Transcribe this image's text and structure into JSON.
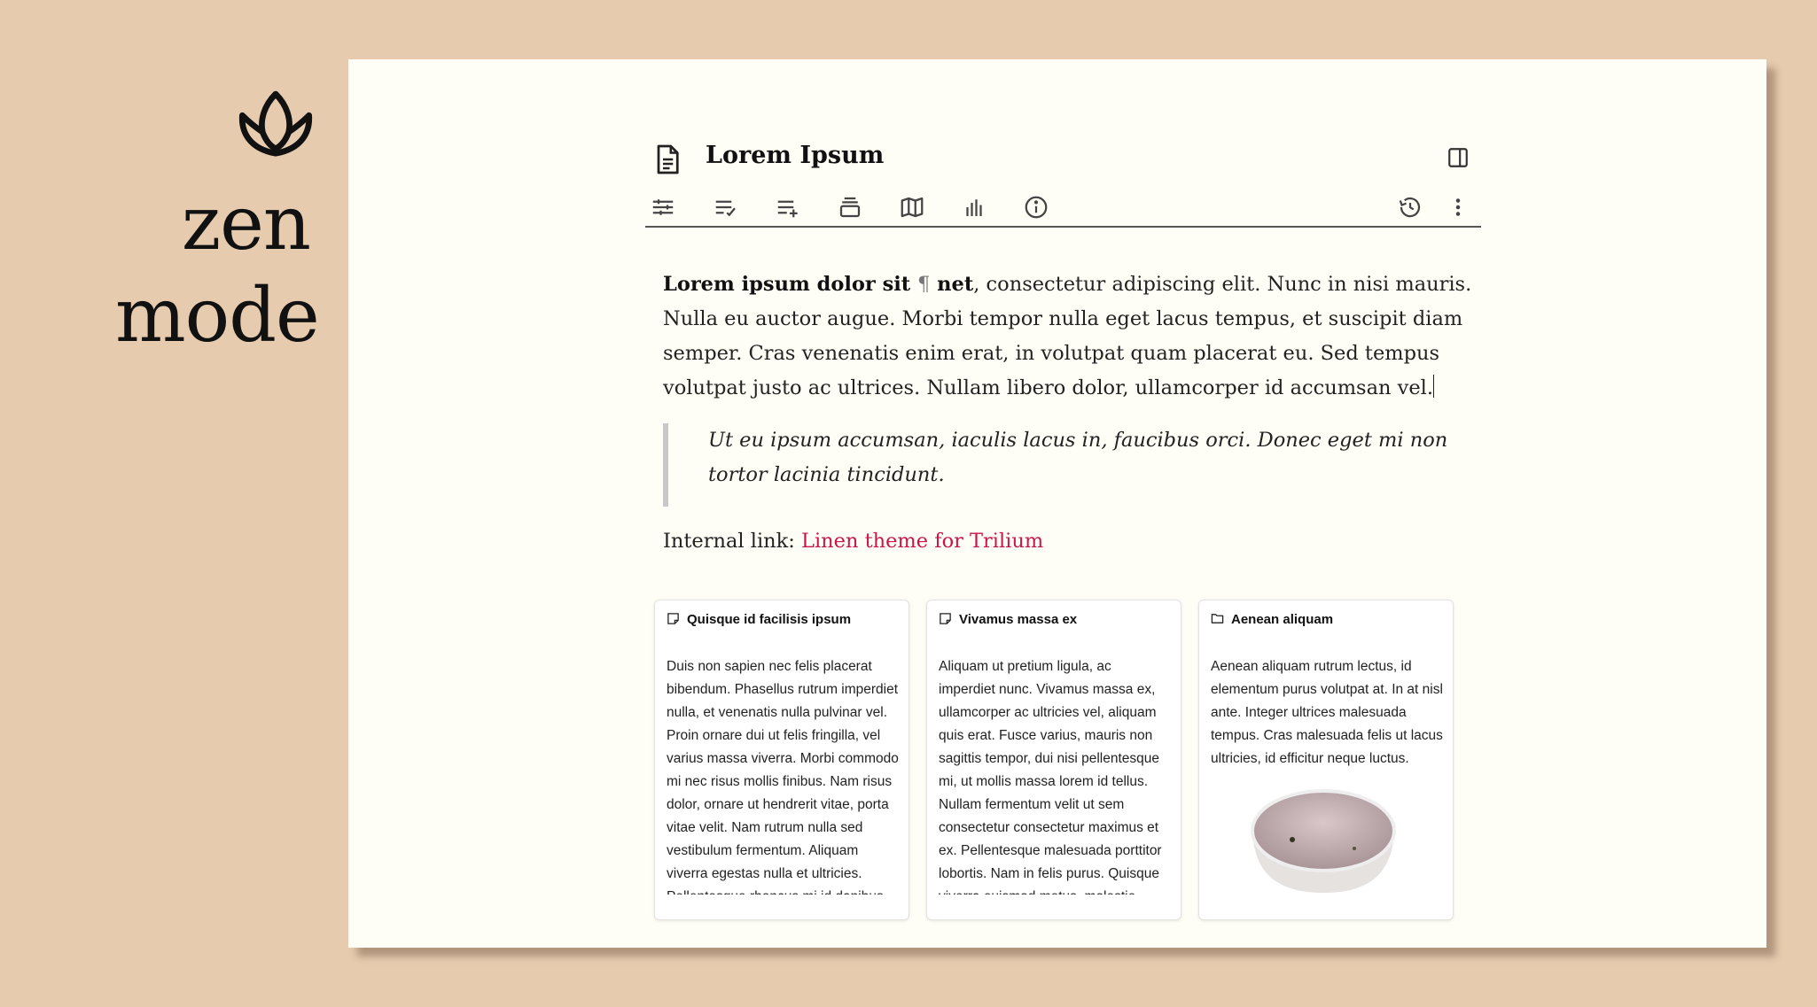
{
  "brand": {
    "line1": "zen",
    "line2": "mode",
    "logo_icon": "lotus-icon"
  },
  "note": {
    "title": "Lorem Ipsum",
    "title_icon": "document-icon",
    "panel_icon": "sidebar-panel-icon"
  },
  "toolbar": {
    "left_icons": [
      "sliders-icon",
      "edit-list-icon",
      "add-list-icon",
      "stack-icon",
      "map-icon",
      "bar-chart-icon",
      "info-icon"
    ],
    "right_icons": [
      "history-icon",
      "more-vertical-icon"
    ]
  },
  "content": {
    "bold_start": "Lorem ipsum dolor sit ",
    "pilcrow": "¶",
    "bold_end": " net",
    "paragraph_rest": ", consectetur adipiscing elit. Nunc in nisi mauris. Nulla eu auctor augue. Morbi tempor nulla eget lacus tempus, et suscipit diam semper. Cras venenatis enim erat, in volutpat quam placerat eu. Sed tempus volutpat justo ac ultrices. Nullam libero dolor, ullamcorper id accumsan vel.",
    "quote": "Ut eu ipsum accumsan, iaculis lacus in, faucibus orci. Donec eget mi non tortor lacinia tincidunt.",
    "link_label": "Internal link: ",
    "link_text": "Linen theme for Trilium"
  },
  "cards": [
    {
      "icon": "note-icon",
      "title": "Quisque id facilisis ipsum",
      "body": "Duis non sapien nec felis placerat bibendum. Phasellus rutrum imperdiet nulla, et venenatis nulla pulvinar vel. Proin ornare dui ut felis fringilla, vel varius massa viverra. Morbi commodo mi nec risus mollis finibus. Nam risus dolor, ornare ut hendrerit vitae, porta vitae velit. Nam rutrum nulla sed vestibulum fermentum. Aliquam viverra egestas nulla et ultricies. Pellentesque rhoncus mi id dapibus"
    },
    {
      "icon": "note-icon",
      "title": "Vivamus massa ex",
      "body": "Aliquam ut pretium ligula, ac imperdiet nunc. Vivamus massa ex, ullamcorper ac ultricies vel, aliquam quis erat. Fusce varius, mauris non sagittis tempor, dui nisi pellentesque mi, ut mollis massa lorem id tellus. Nullam fermentum velit ut sem consectetur consectetur maximus et ex. Pellentesque malesuada porttitor lobortis. Nam in felis purus. Quisque viverra euismod metus, molestie"
    },
    {
      "icon": "folder-icon",
      "title": "Aenean aliquam",
      "body": "Aenean aliquam rutrum lectus, id elementum purus volutpat at. In at nisl ante. Integer ultrices malesuada tempus. Cras malesuada felis ut lacus ultricies, id efficitur neque luctus."
    }
  ],
  "colors": {
    "background": "#e6cbaf",
    "window": "#fffef6",
    "link": "#c8174a"
  }
}
